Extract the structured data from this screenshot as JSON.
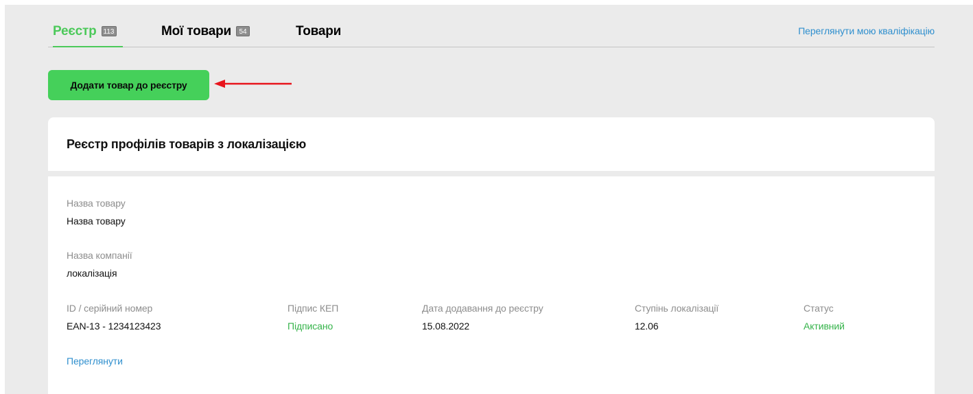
{
  "tabs": [
    {
      "label": "Реєстр",
      "count": "113",
      "active": true
    },
    {
      "label": "Мої товари",
      "count": "54",
      "active": false
    },
    {
      "label": "Товари",
      "count": null,
      "active": false
    }
  ],
  "header": {
    "qualification_link": "Переглянути мою кваліфікацію"
  },
  "toolbar": {
    "add_button_label": "Додати товар до реєстру"
  },
  "registry": {
    "title": "Реєстр профілів товарів з локалізацією",
    "item": {
      "product_name_label": "Назва товару",
      "product_name_value": "Назва товару",
      "company_name_label": "Назва компанії",
      "company_name_value": "локалізація",
      "id_label": "ID / серійний номер",
      "id_value": "EAN-13 - 1234123423",
      "signature_label": "Підпис КЕП",
      "signature_value": "Підписано",
      "date_label": "Дата додавання до реєстру",
      "date_value": "15.08.2022",
      "localization_label": "Ступінь локалізації",
      "localization_value": "12.06",
      "status_label": "Статус",
      "status_value": "Активний",
      "view_link": "Переглянути"
    }
  },
  "colors": {
    "accent_green": "#4cc95a",
    "button_green": "#45d05a",
    "link_blue": "#2f8fce",
    "annotation_arrow": "#e8141c"
  },
  "icons": {
    "annotation": "arrow-left-icon"
  }
}
